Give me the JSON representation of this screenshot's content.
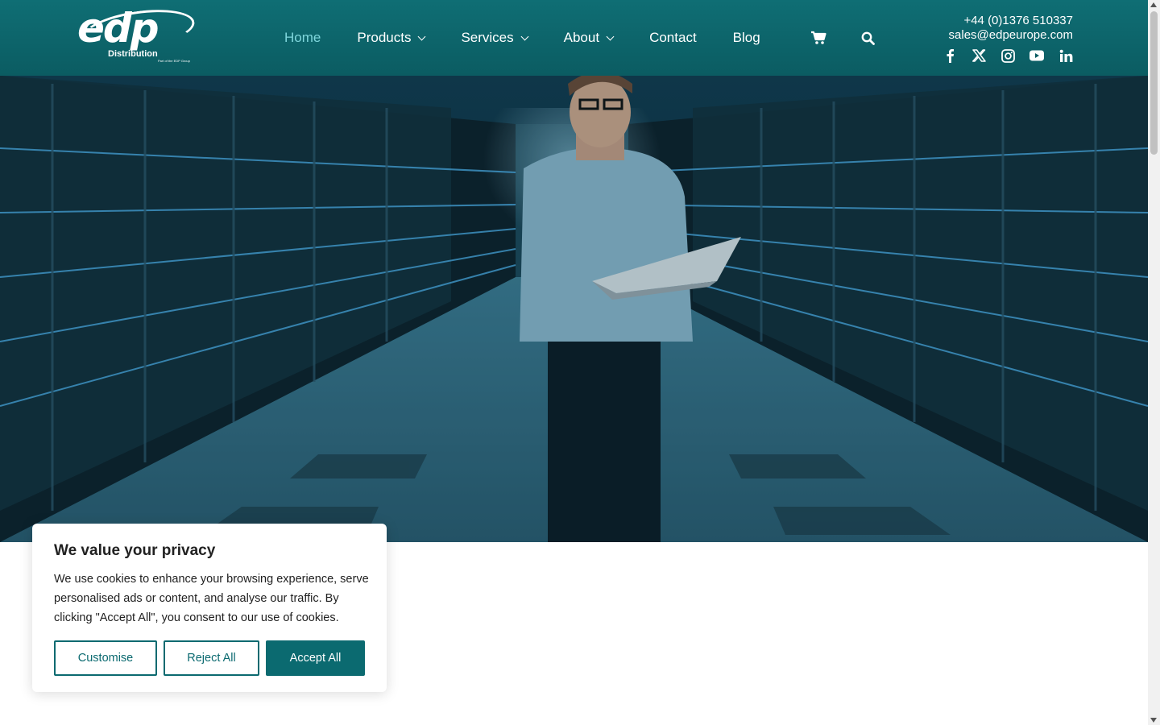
{
  "brand": {
    "logo_main": "edp",
    "logo_sub": "Distribution",
    "logo_tagline": "Part of the EDP Group"
  },
  "nav": {
    "items": [
      {
        "label": "Home",
        "active": true,
        "dropdown": false
      },
      {
        "label": "Products",
        "active": false,
        "dropdown": true
      },
      {
        "label": "Services",
        "active": false,
        "dropdown": true
      },
      {
        "label": "About",
        "active": false,
        "dropdown": true
      },
      {
        "label": "Contact",
        "active": false,
        "dropdown": false
      },
      {
        "label": "Blog",
        "active": false,
        "dropdown": false
      }
    ],
    "cart_icon": "cart-icon",
    "search_icon": "search-icon"
  },
  "contact": {
    "phone": "+44 (0)1376 510337",
    "email": "sales@edpeurope.com"
  },
  "social": [
    "facebook-icon",
    "x-twitter-icon",
    "instagram-icon",
    "youtube-icon",
    "linkedin-icon"
  ],
  "cookie": {
    "title": "We value your privacy",
    "text": "We use cookies to enhance your browsing experience, serve personalised ads or content, and analyse our traffic. By clicking \"Accept All\", you consent to our use of cookies.",
    "customise": "Customise",
    "reject": "Reject All",
    "accept": "Accept All"
  },
  "colors": {
    "header": "#0b5c62",
    "accent": "#0b6a70",
    "active_nav": "#7fd6dc"
  }
}
